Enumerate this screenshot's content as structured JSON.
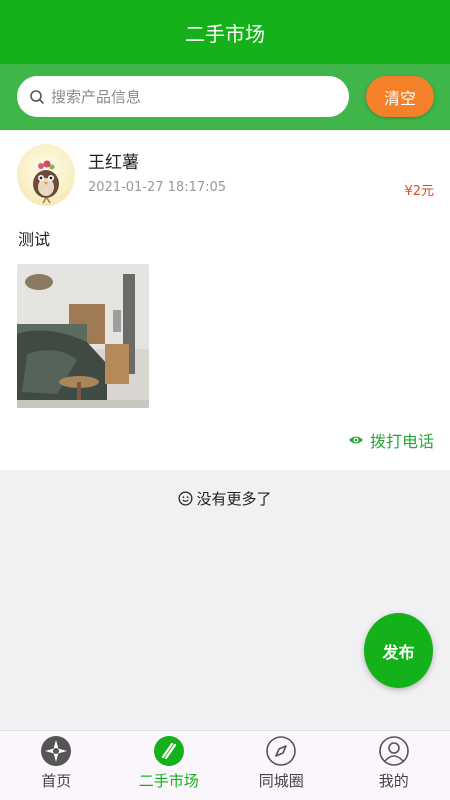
{
  "header": {
    "title": "二手市场"
  },
  "search": {
    "placeholder": "搜索产品信息",
    "clear_label": "清空"
  },
  "post": {
    "username": "王红薯",
    "timestamp": "2021-01-27 18:17:05",
    "price": "¥2元",
    "text": "测试",
    "call_label": "拨打电话"
  },
  "list_footer": {
    "text": "没有更多了"
  },
  "fab": {
    "label": "发布"
  },
  "tabbar": {
    "items": [
      {
        "label": "首页",
        "icon": "compass-dark-icon"
      },
      {
        "label": "二手市场",
        "icon": "market-icon",
        "active": true
      },
      {
        "label": "同城圈",
        "icon": "compass-outline-icon"
      },
      {
        "label": "我的",
        "icon": "user-icon"
      }
    ]
  },
  "colors": {
    "primary": "#14b11a",
    "search_bg": "#3fb54a",
    "clear": "#f5802a",
    "price": "#e2482a"
  }
}
